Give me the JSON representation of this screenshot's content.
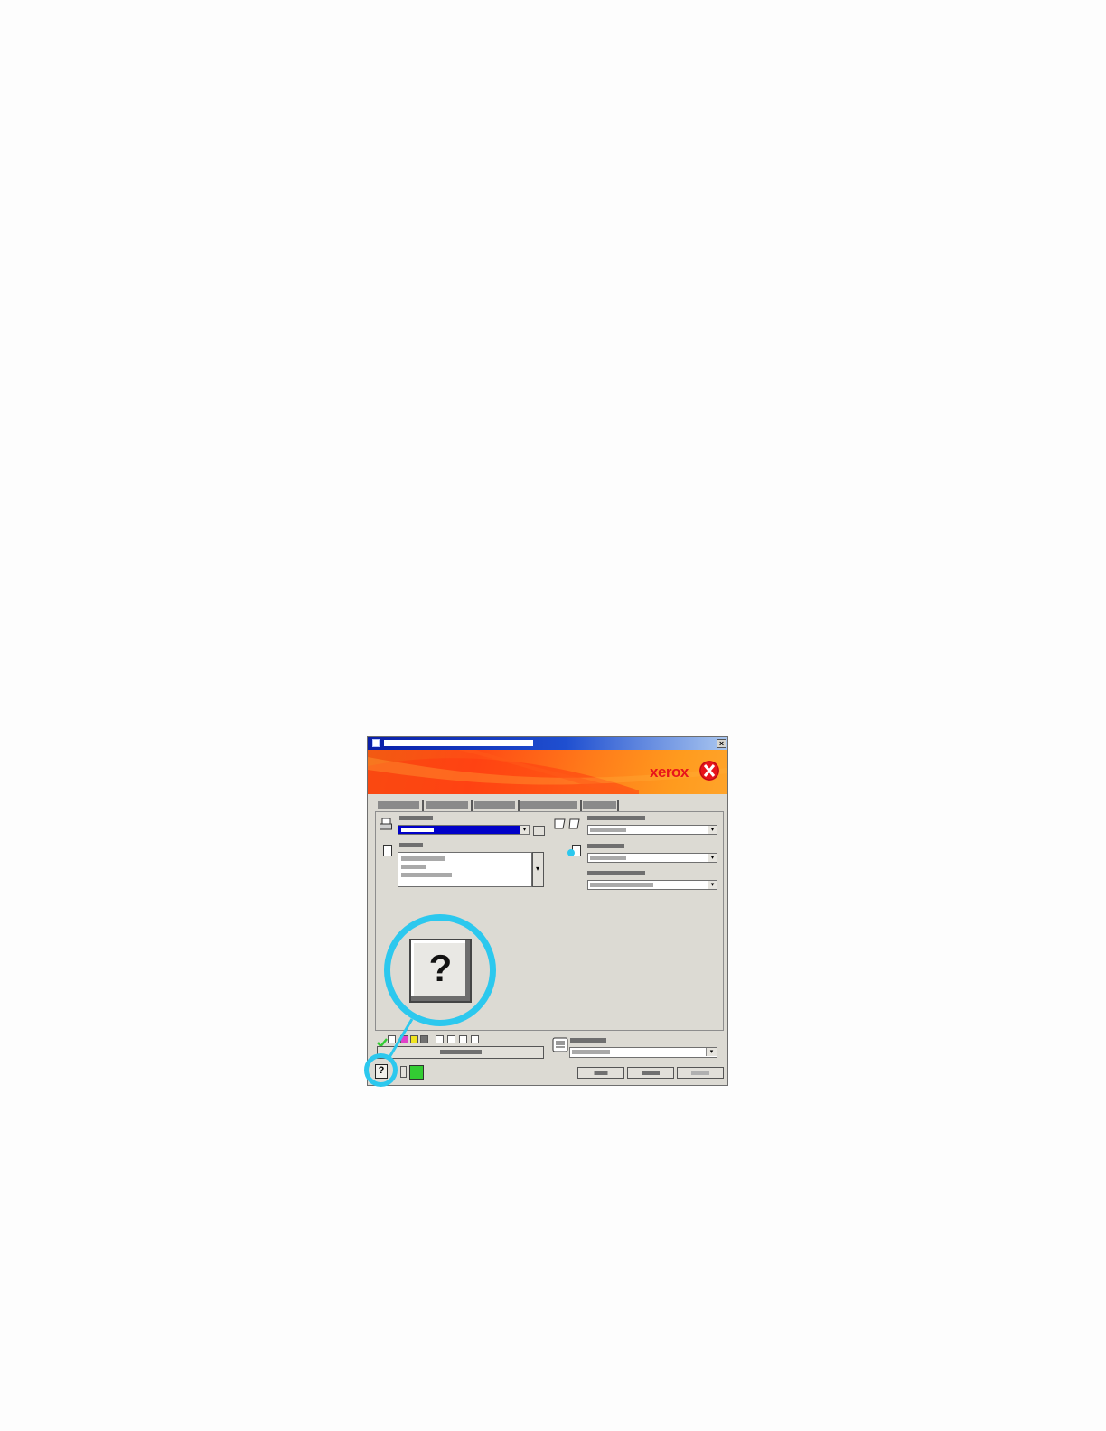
{
  "window": {
    "close_glyph": "×",
    "help_glyph": "?",
    "dropdown_glyph": "▾"
  },
  "banner": {
    "brand": "xerox"
  },
  "colors": {
    "accent": "#2cc8ee",
    "brand_red": "#e8141b",
    "title_blue": "#0a1fa8",
    "banner_orange": "#ff7a1a",
    "selection_blue": "#0000c8",
    "status_green": "#33cc33"
  },
  "icons": {
    "title": "window-icon",
    "close": "close-icon",
    "brand_mark": "xerox-logo-icon",
    "printer": "printer-icon",
    "paper": "paper-icon",
    "orientation": "orientation-icon",
    "color": "color-icon",
    "status_check": "check-icon",
    "job_notes": "notes-icon",
    "help": "help-icon",
    "green_status": "status-icon"
  }
}
